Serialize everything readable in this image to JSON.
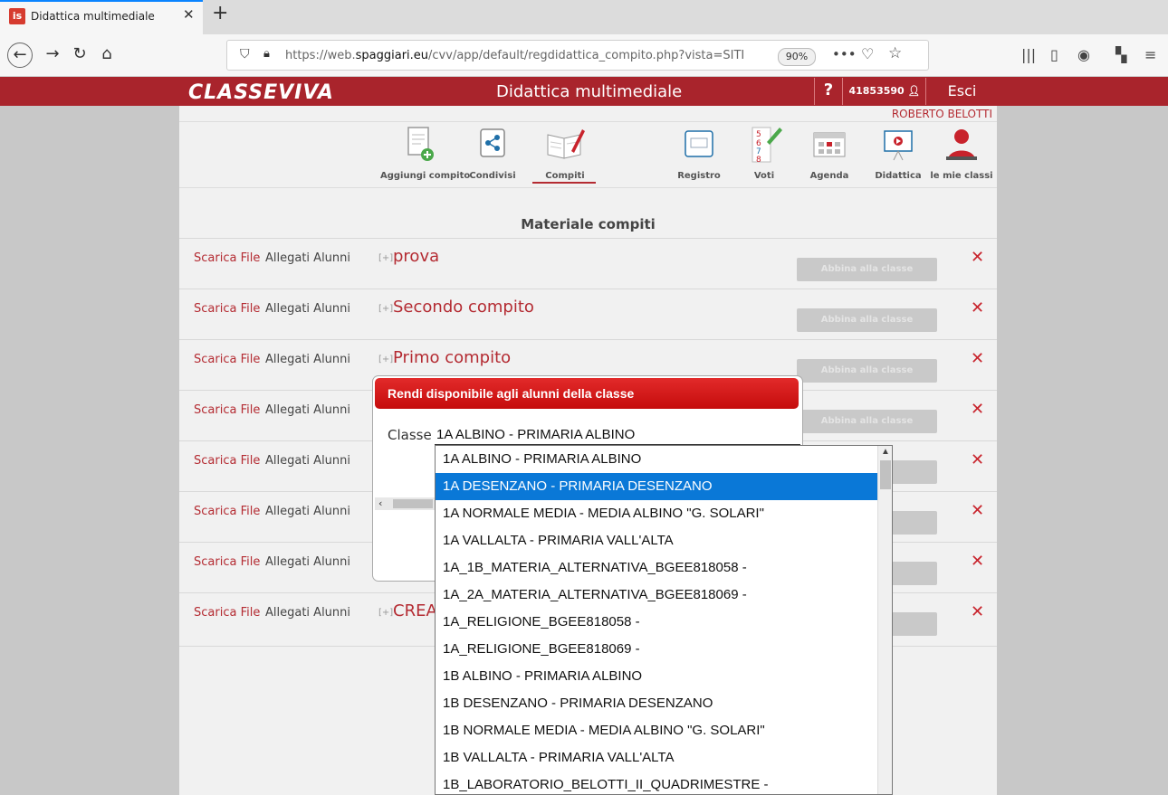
{
  "browser": {
    "tab_title": "Didattica multimediale",
    "favicon_text": "is",
    "url_prefix": "https://web.",
    "url_domain": "spaggiari.eu",
    "url_path": "/cvv/app/default/regdidattica_compito.php?vista=SITI",
    "zoom": "90%"
  },
  "app": {
    "logo": "CLASSEVIVA",
    "title": "Didattica multimediale",
    "help": "?",
    "user_id": "41853590",
    "logout": "Esci",
    "user_name": "ROBERTO BELOTTI"
  },
  "nav": [
    {
      "label": "Aggiungi compito",
      "icon": "add-task-icon"
    },
    {
      "label": "Condivisi",
      "icon": "share-icon"
    },
    {
      "label": "Compiti",
      "icon": "book-pen-icon"
    },
    {
      "label": "Registro",
      "icon": "register-icon"
    },
    {
      "label": "Voti",
      "icon": "grades-icon"
    },
    {
      "label": "Agenda",
      "icon": "calendar-icon"
    },
    {
      "label": "Didattica",
      "icon": "presentation-icon"
    },
    {
      "label": "le mie classi",
      "icon": "teacher-icon"
    }
  ],
  "section_title": "Materiale compiti",
  "rows": [
    {
      "scarica": "Scarica File",
      "allegati": "Allegati Alunni",
      "plus": "[+]",
      "title": "prova",
      "abbina": "Abbina alla classe"
    },
    {
      "scarica": "Scarica File",
      "allegati": "Allegati Alunni",
      "plus": "[+]",
      "title": "Secondo compito",
      "abbina": "Abbina alla classe"
    },
    {
      "scarica": "Scarica File",
      "allegati": "Allegati Alunni",
      "plus": "[+]",
      "title": "Primo compito",
      "abbina": "Abbina alla classe"
    },
    {
      "scarica": "Scarica File",
      "allegati": "Allegati Alunni",
      "plus": "",
      "title": "",
      "abbina": "Abbina alla classe"
    },
    {
      "scarica": "Scarica File",
      "allegati": "Allegati Alunni",
      "plus": "",
      "title": "",
      "abbina": "classe"
    },
    {
      "scarica": "Scarica File",
      "allegati": "Allegati Alunni",
      "plus": "",
      "title": "",
      "abbina": "classe"
    },
    {
      "scarica": "Scarica File",
      "allegati": "Allegati Alunni",
      "plus": "",
      "title": "",
      "abbina": "classe"
    },
    {
      "scarica": "Scarica File",
      "allegati": "Allegati Alunni",
      "plus": "[+]",
      "title": "CREA",
      "abbina": "classe"
    }
  ],
  "modal": {
    "title": "Rendi disponibile agli alunni della classe",
    "classe_label": "Classe",
    "selected_value": "1A ALBINO - PRIMARIA ALBINO"
  },
  "dropdown": {
    "highlighted_index": 1,
    "options": [
      "1A ALBINO - PRIMARIA ALBINO",
      "1A DESENZANO - PRIMARIA DESENZANO",
      "1A NORMALE MEDIA - MEDIA ALBINO \"G. SOLARI\"",
      "1A VALLALTA - PRIMARIA VALL'ALTA",
      "1A_1B_MATERIA_ALTERNATIVA_BGEE818058 -",
      "1A_2A_MATERIA_ALTERNATIVA_BGEE818069 -",
      "1A_RELIGIONE_BGEE818058 -",
      "1A_RELIGIONE_BGEE818069 -",
      "1B ALBINO - PRIMARIA ALBINO",
      "1B DESENZANO - PRIMARIA DESENZANO",
      "1B NORMALE MEDIA - MEDIA ALBINO \"G. SOLARI\"",
      "1B VALLALTA - PRIMARIA VALL'ALTA",
      "1B_LABORATORIO_BELOTTI_II_QUADRIMESTRE -"
    ]
  },
  "colors": {
    "brand": "#a9242c",
    "accent": "#b42b32",
    "highlight": "#0a78d7"
  }
}
